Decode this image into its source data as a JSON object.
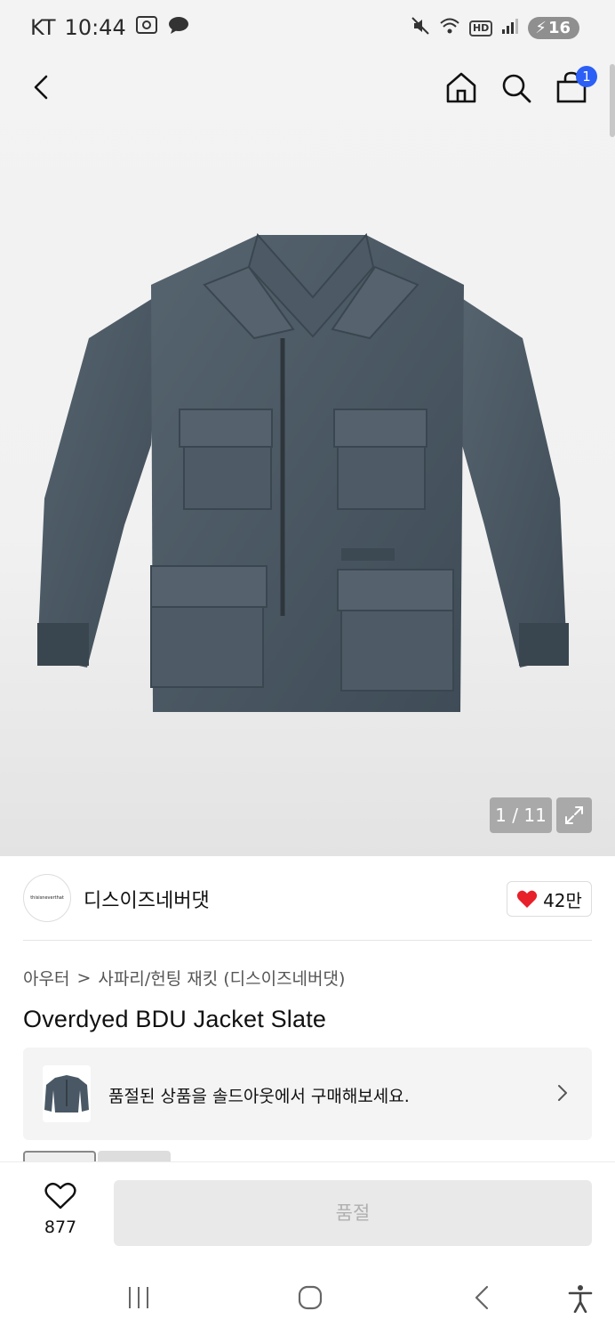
{
  "status_bar": {
    "carrier": "KT",
    "time": "10:44",
    "network_badge": "HD",
    "battery_level": "16"
  },
  "nav": {
    "cart_count": "1"
  },
  "gallery": {
    "counter": "1 / 11"
  },
  "brand": {
    "logo_text": "thisisneverthat",
    "name": "디스이즈네버댓",
    "like_count": "42만"
  },
  "breadcrumb": {
    "category": "아우터",
    "separator": ">",
    "subcategory": "사파리/헌팅 재킷 (디스이즈네버댓)"
  },
  "product": {
    "title": "Overdyed BDU Jacket Slate"
  },
  "soldout_banner": {
    "text": "품절된 상품을 솔드아웃에서 구매해보세요."
  },
  "bottom_bar": {
    "wish_count": "877",
    "buy_label": "품절"
  },
  "colors": {
    "accent_blue": "#2b5ff6",
    "heart_red": "#e8202a",
    "jacket": "#4a5866"
  }
}
